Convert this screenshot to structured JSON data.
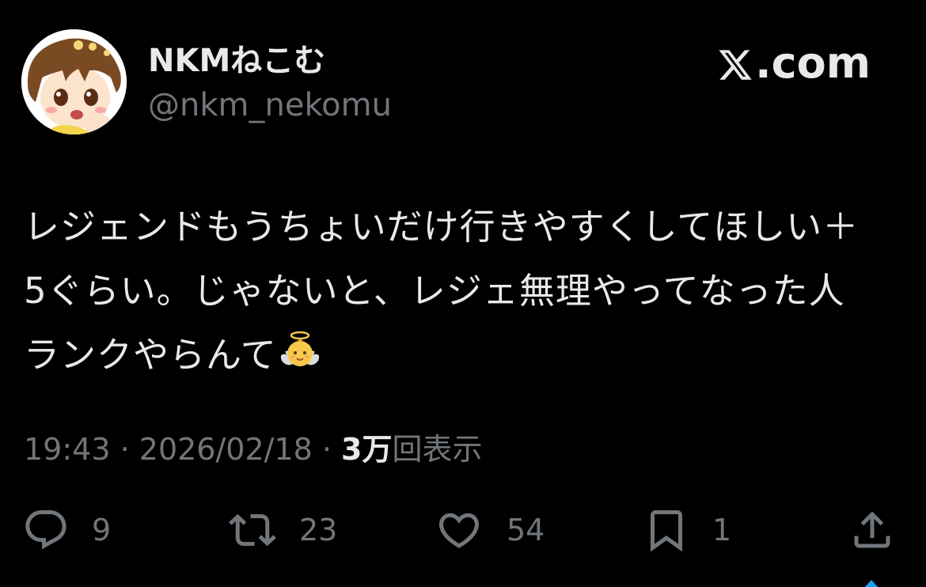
{
  "header": {
    "display_name": "NKMねこむ",
    "handle": "@nkm_nekomu",
    "brand_text": ".com",
    "brand_icon": "x-logo-icon",
    "avatar_icon": "avatar"
  },
  "tweet": {
    "lines": [
      "レジェンドもうちょいだけ行きやすくしてほしい＋",
      "5ぐらい。じゃないと、レジェ無理やってなった人",
      "ランクやらんて"
    ],
    "emoji": "baby-angel-icon"
  },
  "meta": {
    "time": "19:43",
    "sep1": " · ",
    "date": "2026/02/18",
    "sep2": " · ",
    "views_count": "3万",
    "views_label": "回表示"
  },
  "actions": {
    "reply": {
      "icon": "reply-icon",
      "count": "9"
    },
    "retweet": {
      "icon": "retweet-icon",
      "count": "23"
    },
    "like": {
      "icon": "heart-icon",
      "count": "54"
    },
    "bookmark": {
      "icon": "bookmark-icon",
      "count": "1"
    },
    "share": {
      "icon": "share-icon"
    }
  },
  "colors": {
    "background": "#000000",
    "primary_text": "#e7e9ea",
    "secondary_text": "#71767b",
    "accent": "#1d9bf0"
  }
}
